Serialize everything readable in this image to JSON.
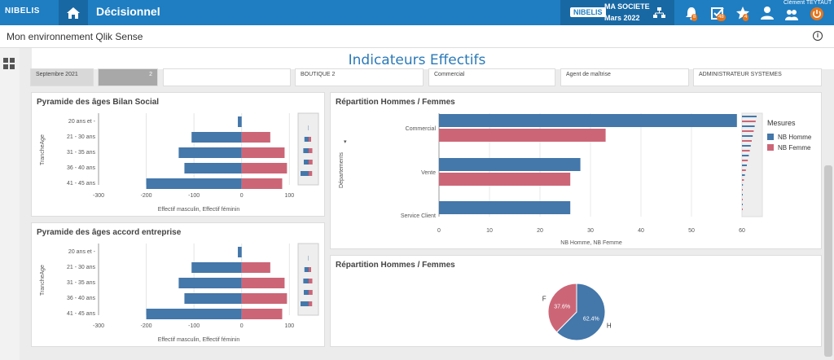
{
  "header": {
    "logo": "NIBELIS",
    "app_title": "Décisionnel",
    "company_logo": "NIBELIS",
    "company_name": "MA SOCIETE",
    "company_period": "Mars 2022",
    "user_name": "Clément TEYTAUT",
    "badges": [
      "8",
      "48",
      "4"
    ]
  },
  "subheader": {
    "title": "Mon environnement Qlik Sense"
  },
  "sheet": {
    "title": "Indicateurs Effectifs"
  },
  "filters": [
    {
      "values": [
        "Septembre 2021"
      ]
    },
    {
      "values": [
        "2"
      ]
    },
    {
      "values": [
        "BOUTIQUE 2"
      ]
    },
    {
      "values": [
        "Commercial"
      ]
    },
    {
      "values": [
        "Agent de maîtrise"
      ]
    },
    {
      "values": [
        "ADMINISTRATEUR SYSTEMES"
      ]
    }
  ],
  "colors": {
    "homme": "#4477aa",
    "femme": "#cc6677",
    "brand": "#1f7ec2"
  },
  "chart_data": [
    {
      "type": "bar",
      "title": "Pyramide des âges Bilan Social",
      "ylabel": "TrancheAge",
      "xlabel": "Effectif masculin, Effectif féminin",
      "categories": [
        "20 ans et -",
        "21 - 30 ans",
        "31 - 35 ans",
        "36 - 40 ans",
        "41 - 45 ans"
      ],
      "series": [
        {
          "values": [
            -8,
            -105,
            -132,
            -120,
            -200
          ]
        },
        {
          "values": [
            0,
            60,
            90,
            95,
            85
          ]
        }
      ],
      "xlim": [
        -300,
        120
      ],
      "xticks": [
        "-300",
        "-200",
        "-100",
        "0",
        "100"
      ]
    },
    {
      "type": "bar",
      "title": "Pyramide des âges accord entreprise",
      "ylabel": "TrancheAge",
      "xlabel": "Effectif masculin, Effectif féminin",
      "categories": [
        "20 ans et -",
        "21 - 30 ans",
        "31 - 35 ans",
        "36 - 40 ans",
        "41 - 45 ans"
      ],
      "series": [
        {
          "values": [
            -8,
            -105,
            -132,
            -120,
            -200
          ]
        },
        {
          "values": [
            0,
            60,
            90,
            95,
            85
          ]
        }
      ],
      "xlim": [
        -300,
        120
      ],
      "xticks": [
        "-300",
        "-200",
        "-100",
        "0",
        "100"
      ]
    },
    {
      "type": "bar",
      "title": "Répartition Hommes / Femmes",
      "ylabel": "Départements",
      "xlabel": "NB Homme, NB Femme",
      "legend_title": "Mesures",
      "categories": [
        "Commercial",
        "Vente",
        "Service Client"
      ],
      "series": [
        {
          "name": "NB Homme",
          "values": [
            59,
            28,
            26
          ]
        },
        {
          "name": "NB Femme",
          "values": [
            33,
            26,
            0
          ]
        }
      ],
      "xlim": [
        0,
        60
      ],
      "xticks": [
        "0",
        "10",
        "20",
        "30",
        "40",
        "50",
        "60"
      ]
    },
    {
      "type": "pie",
      "title": "Répartition Hommes / Femmes",
      "labels": [
        "H",
        "F"
      ],
      "values": [
        62.4,
        37.6
      ],
      "value_labels": [
        "62.4%",
        "37.6%"
      ]
    }
  ]
}
